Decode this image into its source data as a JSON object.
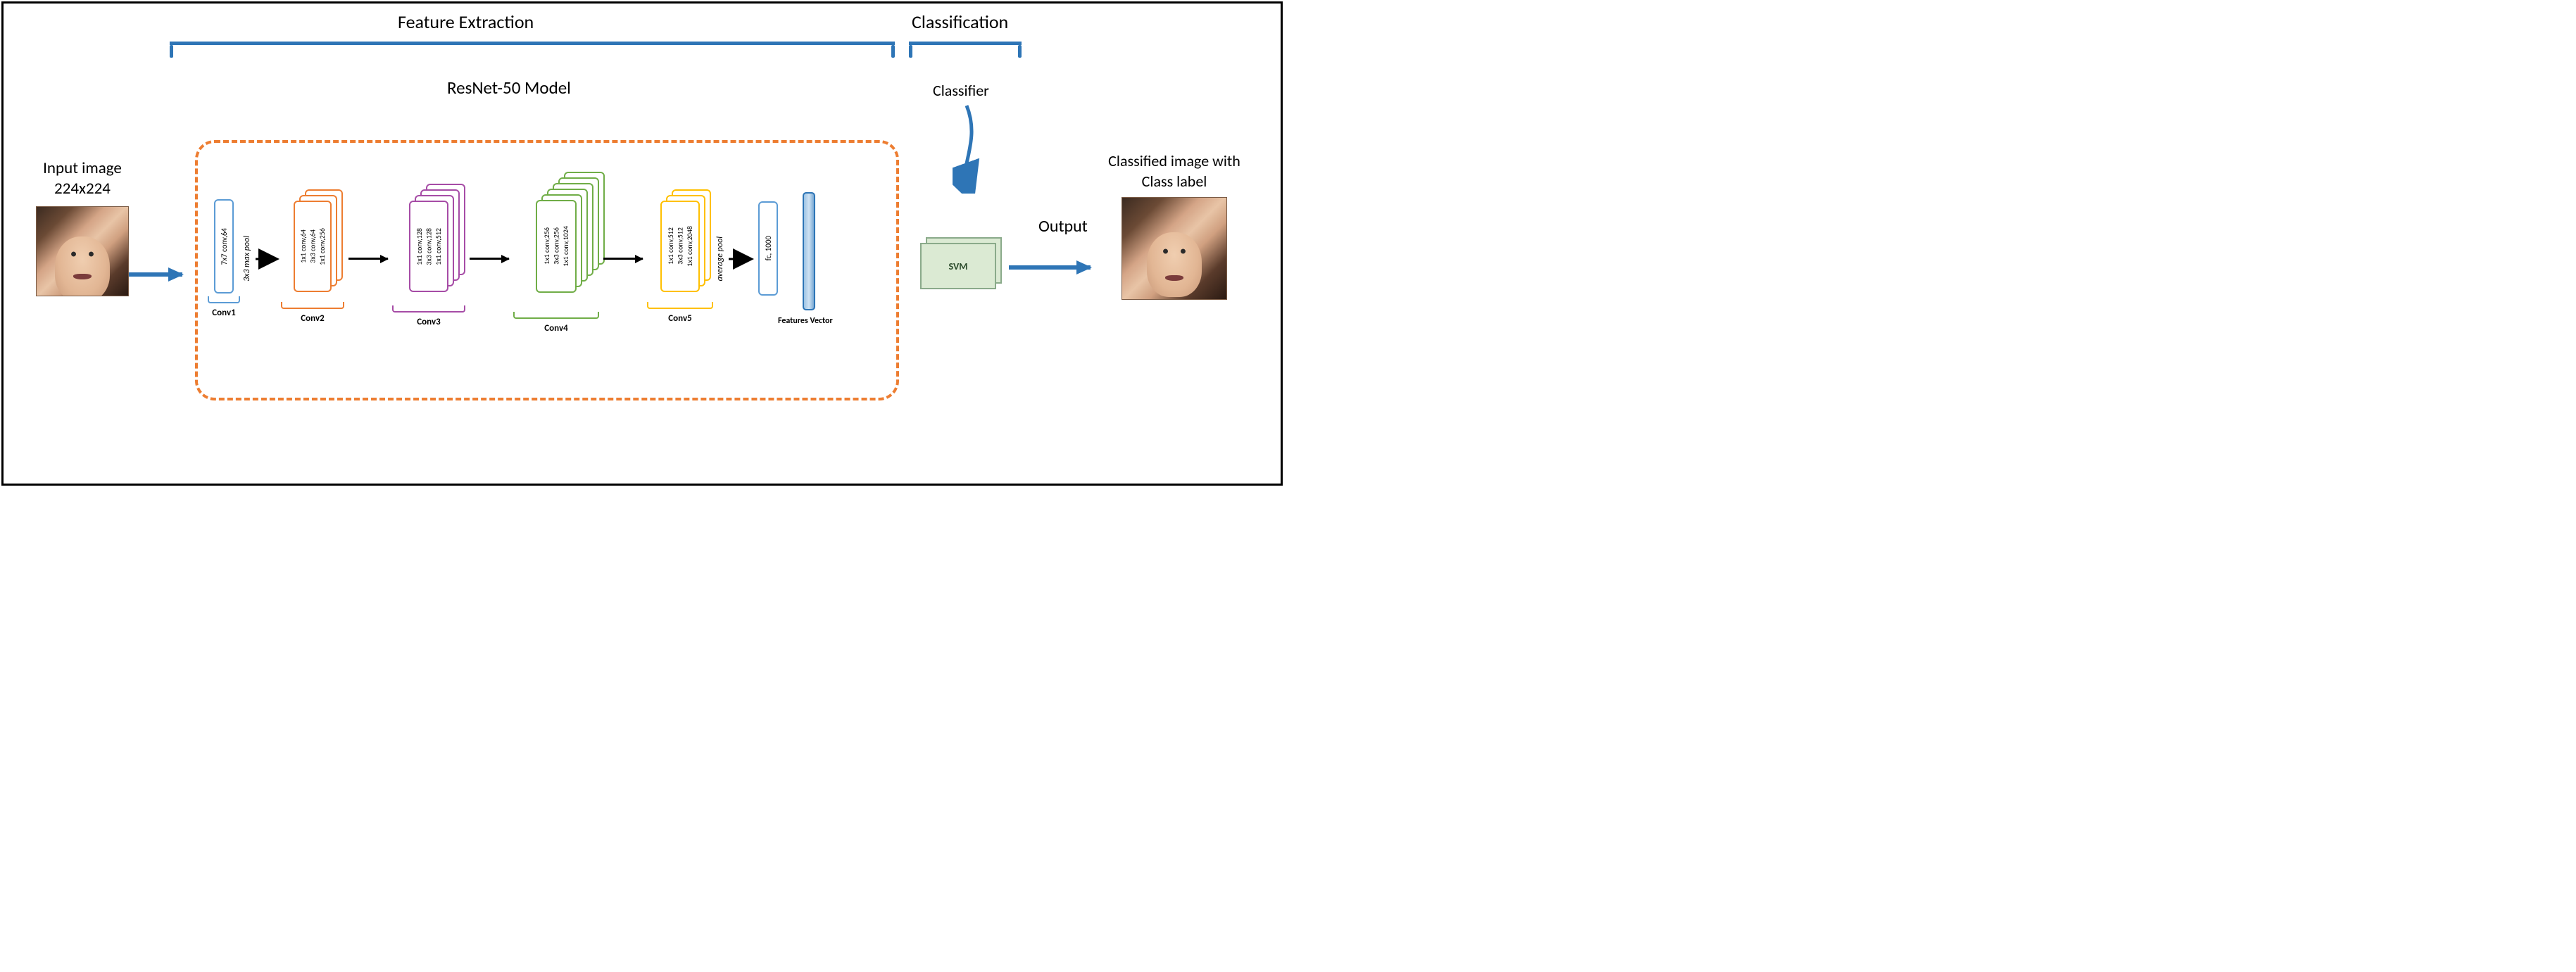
{
  "headers": {
    "feature_extraction": "Feature Extraction",
    "classification": "Classification",
    "model_title": "ResNet-50 Model",
    "classifier": "Classifier"
  },
  "input": {
    "label_line1": "Input image",
    "label_line2": "224x224"
  },
  "output": {
    "label_line1": "Classified image with",
    "label_line2": "Class label",
    "arrow_label": "Output"
  },
  "pipeline": {
    "conv1": {
      "text": "7x7 conv,64",
      "below": "Conv1"
    },
    "pool1": "3x3 max pool",
    "conv2": {
      "l1": "1x1 conv,64",
      "l2": "3x3 conv,64",
      "l3": "1x1 conv,256",
      "below": "Conv2"
    },
    "conv3": {
      "l1": "1x1 conv,128",
      "l2": "3x3 conv,128",
      "l3": "1x1 conv,512",
      "below": "Conv3"
    },
    "conv4": {
      "l1": "1x1 conv,256",
      "l2": "3x3 conv,256",
      "l3": "1x1 conv,1024",
      "below": "Conv4"
    },
    "conv5": {
      "l1": "1x1 conv,512",
      "l2": "3x3 conv,512",
      "l3": "1x1 conv,2048",
      "below": "Conv5"
    },
    "avgpool": "average pool",
    "fc": "fc, 1000",
    "features_vector_label": "Features Vector"
  },
  "classifier_box": "SVM",
  "chart_data": {
    "type": "diagram",
    "title": "ResNet-50 feature extraction + SVM classifier pipeline",
    "input_size": [
      224,
      224
    ],
    "stages": [
      {
        "name": "Conv1",
        "ops": [
          "7x7 conv,64"
        ],
        "color": "#5b9bd5",
        "repeat": 1
      },
      {
        "name": "MaxPool",
        "ops": [
          "3x3 max pool"
        ],
        "repeat": 1
      },
      {
        "name": "Conv2",
        "ops": [
          "1x1 conv,64",
          "3x3 conv,64",
          "1x1 conv,256"
        ],
        "color": "#ed7d31",
        "repeat": 3
      },
      {
        "name": "Conv3",
        "ops": [
          "1x1 conv,128",
          "3x3 conv,128",
          "1x1 conv,512"
        ],
        "color": "#a64ca6",
        "repeat": 4
      },
      {
        "name": "Conv4",
        "ops": [
          "1x1 conv,256",
          "3x3 conv,256",
          "1x1 conv,1024"
        ],
        "color": "#70ad47",
        "repeat": 6
      },
      {
        "name": "Conv5",
        "ops": [
          "1x1 conv,512",
          "3x3 conv,512",
          "1x1 conv,2048"
        ],
        "color": "#ffc000",
        "repeat": 3
      },
      {
        "name": "AvgPool",
        "ops": [
          "average pool"
        ],
        "repeat": 1
      },
      {
        "name": "FC",
        "ops": [
          "fc, 1000"
        ],
        "color": "#5b9bd5",
        "repeat": 1
      },
      {
        "name": "FeaturesVector",
        "ops": [],
        "repeat": 1
      }
    ],
    "classifier": "SVM",
    "output": "Classified image with Class label"
  }
}
